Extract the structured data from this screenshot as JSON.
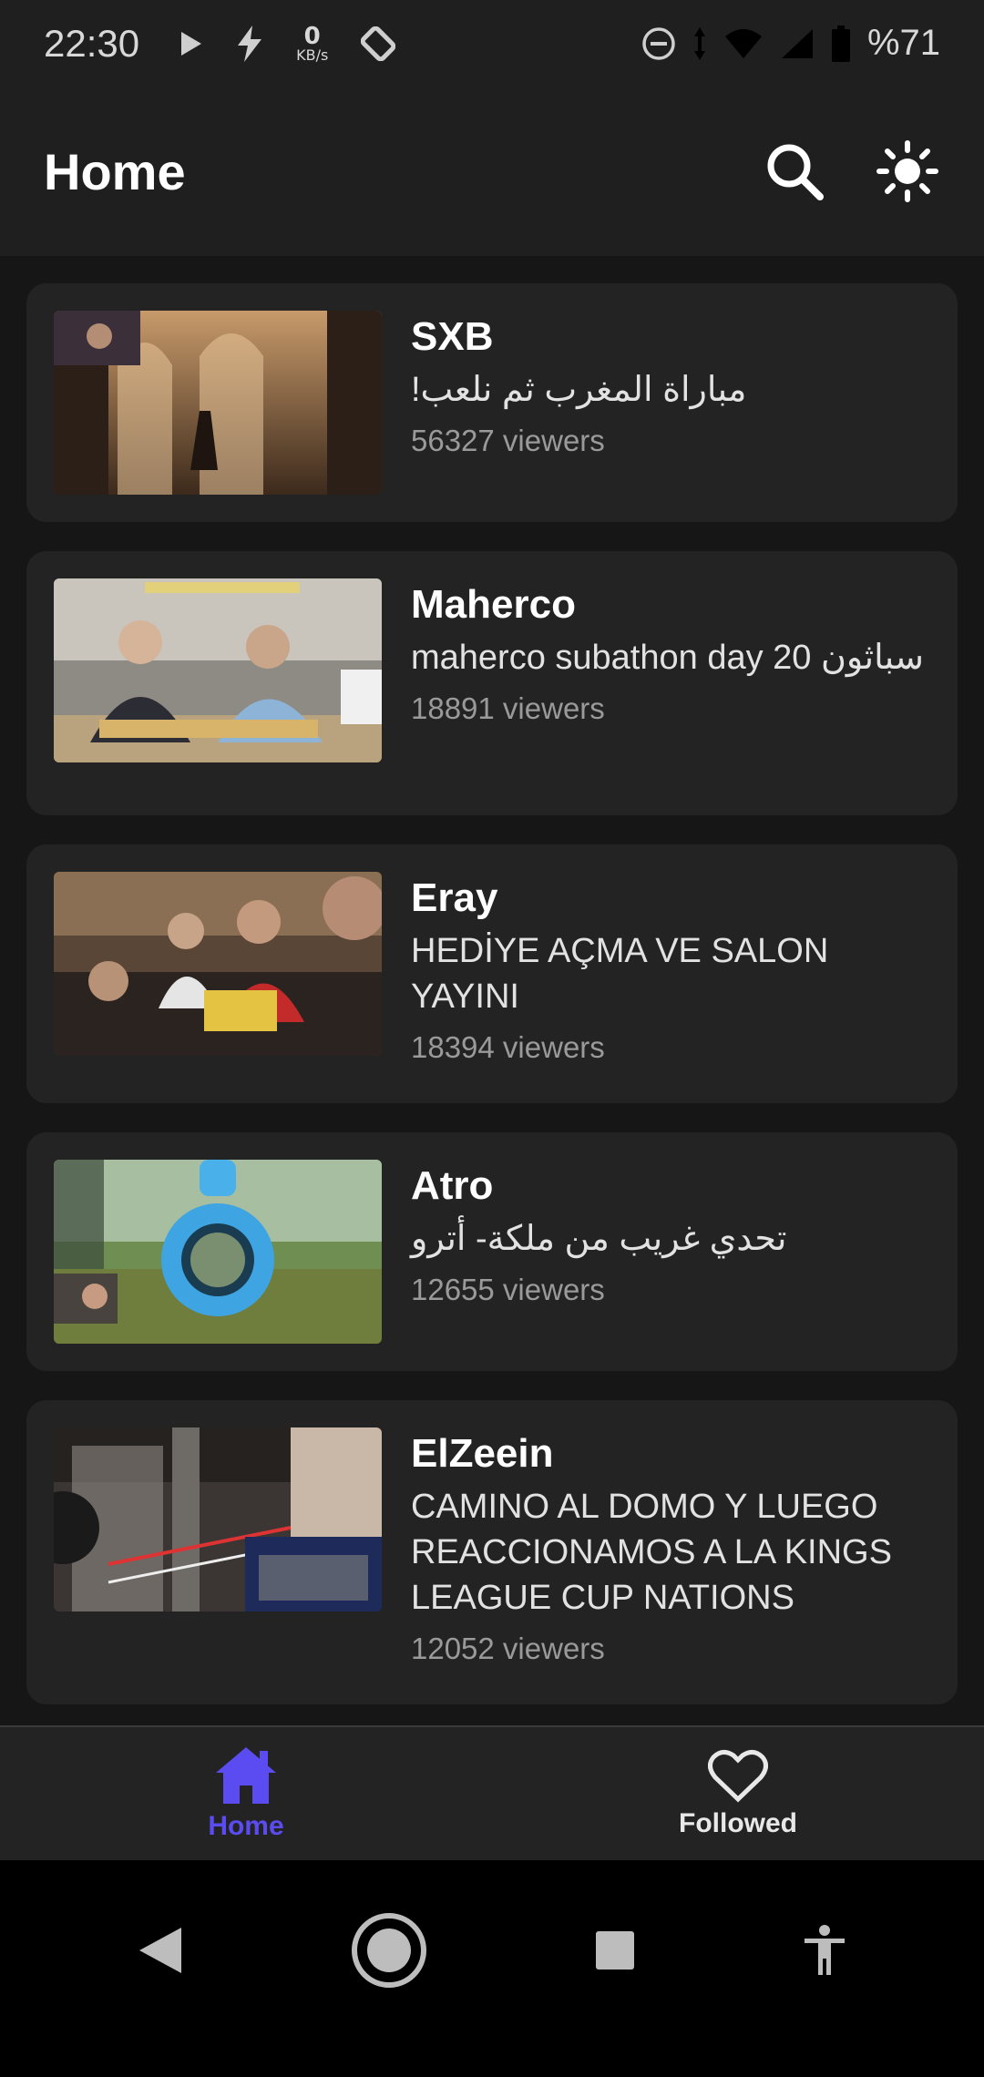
{
  "status_bar": {
    "time": "22:30",
    "kbs_value": "0",
    "kbs_unit": "KB/s",
    "battery": "%71"
  },
  "app_bar": {
    "title": "Home"
  },
  "streams": [
    {
      "name": "SXB",
      "title": "مباراة المغرب ثم نلعب!",
      "viewers": "56327 viewers"
    },
    {
      "name": "Maherco",
      "title": "maherco subathon day 20 سباثون",
      "viewers": "18891 viewers"
    },
    {
      "name": "Eray",
      "title": "HEDİYE AÇMA VE SALON YAYINI",
      "viewers": "18394 viewers"
    },
    {
      "name": "Atro",
      "title": "تحدي غريب من ملكة- أترو",
      "viewers": "12655 viewers"
    },
    {
      "name": "ElZeein",
      "title": "CAMINO AL DOMO Y LUEGO REACCIONAMOS A LA KINGS LEAGUE CUP NATIONS",
      "viewers": "12052 viewers"
    }
  ],
  "bottom_nav": {
    "home_label": "Home",
    "followed_label": "Followed"
  },
  "colors": {
    "accent": "#5a4cf0",
    "background": "#161616",
    "card": "#232323"
  }
}
